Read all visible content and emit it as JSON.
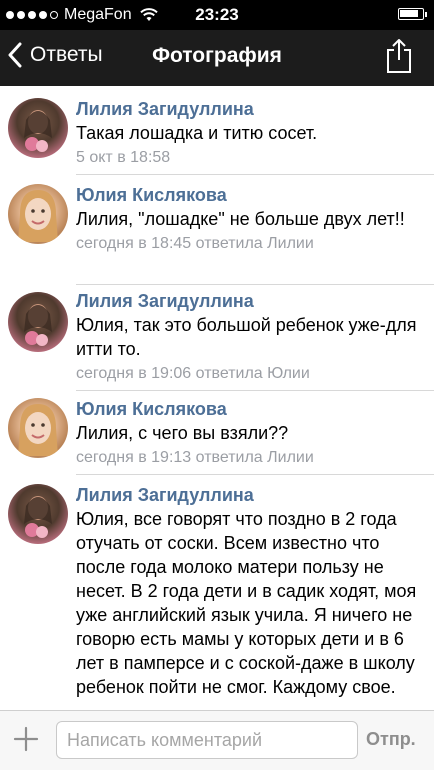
{
  "status_bar": {
    "carrier": "MegaFon",
    "time": "23:23",
    "signal_bars_filled": 4,
    "signal_bars_total": 5,
    "battery_level": 0.85
  },
  "nav": {
    "back_label": "Ответы",
    "title": "Фотография",
    "share_icon": "share-icon"
  },
  "comments": [
    {
      "author": "Лилия Загидуллина",
      "text": "Такая лошадка и титю сосет.",
      "meta": "5 окт в 18:58",
      "avatar": "avatar-lilia"
    },
    {
      "author": "Юлия Кислякова",
      "text": "Лилия, \"лошадке\" не больше двух лет!!",
      "meta": "сегодня в 18:45 ответила Лилии",
      "avatar": "avatar-yulia"
    },
    {
      "author": "Лилия Загидуллина",
      "text": "Юлия, так это большой ребенок уже-для итти то.",
      "meta": "сегодня в 19:06 ответила Юлии",
      "avatar": "avatar-lilia"
    },
    {
      "author": "Юлия Кислякова",
      "text": "Лилия, с чего вы взяли??",
      "meta": "сегодня в 19:13 ответила Лилии",
      "avatar": "avatar-yulia"
    },
    {
      "author": "Лилия Загидуллина",
      "text": "Юлия, все говорят что поздно в 2 года отучать от соски. Всем известно что после года молоко матери пользу не несет. В 2 года дети и в садик ходят, моя уже английский язык учила. Я ничего не говорю есть мамы у которых дети и в 6 лет в памперсе и с соской-даже в школу ребенок пойти не смог. Каждому свое.",
      "meta": "",
      "avatar": "avatar-lilia"
    }
  ],
  "composer": {
    "placeholder": "Написать комментарий",
    "send_label": "Отпр."
  },
  "colors": {
    "author": "#4d6f96",
    "meta": "#9b9ea4",
    "nav_bg": "#1c1c1c"
  }
}
